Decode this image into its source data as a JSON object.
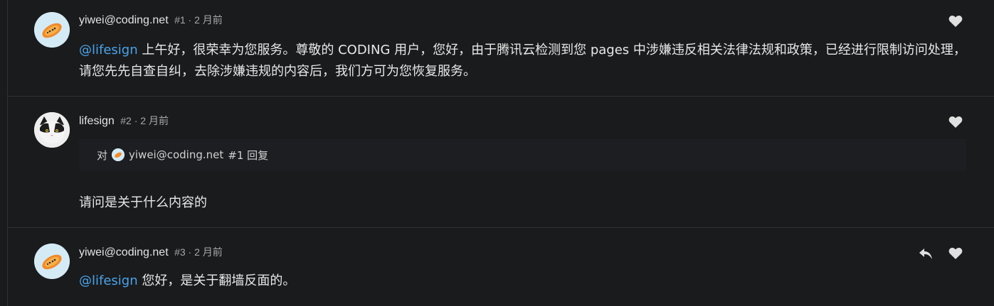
{
  "posts": [
    {
      "author": "yiwei@coding.net",
      "meta": "#1 · 2 月前",
      "mention": "@lifesign",
      "body": " 上午好，很荣幸为您服务。尊敬的 CODING 用户，您好，由于腾讯云检测到您 pages 中涉嫌违反相关法律法规和政策，已经进行限制访问处理，请您先先自查自纠，去除涉嫌违规的内容后，我们方可为您恢复服务。",
      "avatar_icon": "papaya-avatar-icon"
    },
    {
      "author": "lifesign",
      "meta": "#2 · 2 月前",
      "reply_prefix": "对",
      "reply_author": "yiwei@coding.net",
      "reply_suffix": "#1 回复",
      "body": "请问是关于什么内容的",
      "avatar_icon": "cat-avatar-icon"
    },
    {
      "author": "yiwei@coding.net",
      "meta": "#3 · 2 月前",
      "mention": "@lifesign",
      "body": " 您好，是关于翻墙反面的。",
      "avatar_icon": "papaya-avatar-icon"
    }
  ],
  "colors": {
    "background": "#1a1b1d",
    "mention": "#4aa3ea",
    "divider": "#2f3033",
    "icon": "#e0e0e0"
  }
}
